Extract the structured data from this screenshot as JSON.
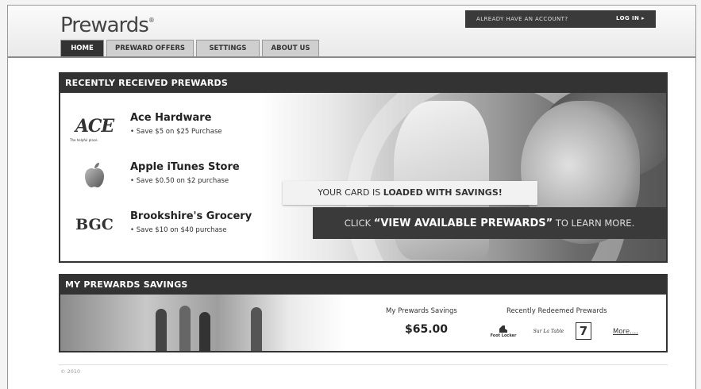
{
  "header": {
    "logo": "Prewards",
    "logo_mark": "®",
    "account_prompt": "ALREADY HAVE AN ACCOUNT?",
    "login_label": "LOG IN ▸"
  },
  "tabs": [
    {
      "label": "HOME",
      "active": true
    },
    {
      "label": "PREWARD OFFERS",
      "active": false
    },
    {
      "label": "SETTINGS",
      "active": false
    },
    {
      "label": "ABOUT US",
      "active": false
    }
  ],
  "recent": {
    "title": "RECENTLY RECEIVED PREWARDS",
    "offers": [
      {
        "logo_text": "ACE",
        "logo_tagline": "The helpful place.",
        "name": "Ace Hardware",
        "deal": "• Save $5 on $25 Purchase"
      },
      {
        "logo_icon": "apple-icon",
        "name": "Apple iTunes Store",
        "deal": "• Save $0.50 on $2 purchase"
      },
      {
        "logo_text": "BGC",
        "name": "Brookshire's Grocery",
        "deal": "• Save $10 on $40 purchase"
      }
    ],
    "promo_prefix": "YOUR CARD IS ",
    "promo_bold": "LOADED WITH SAVINGS!",
    "cta_prefix": "CLICK ",
    "cta_bold": "“VIEW AVAILABLE PREWARDS”",
    "cta_suffix": " TO LEARN MORE."
  },
  "savings": {
    "title": "MY PREWARDS SAVINGS",
    "savings_label": "My Prewards Savings",
    "savings_value": "$65.00",
    "redeemed_label": "Recently Redeemed Prewards",
    "redeemed_logos": [
      "Foot Locker",
      "Sur La Table",
      "7"
    ],
    "more_label": "More...."
  },
  "footer": {
    "copyright": "© 2010"
  }
}
